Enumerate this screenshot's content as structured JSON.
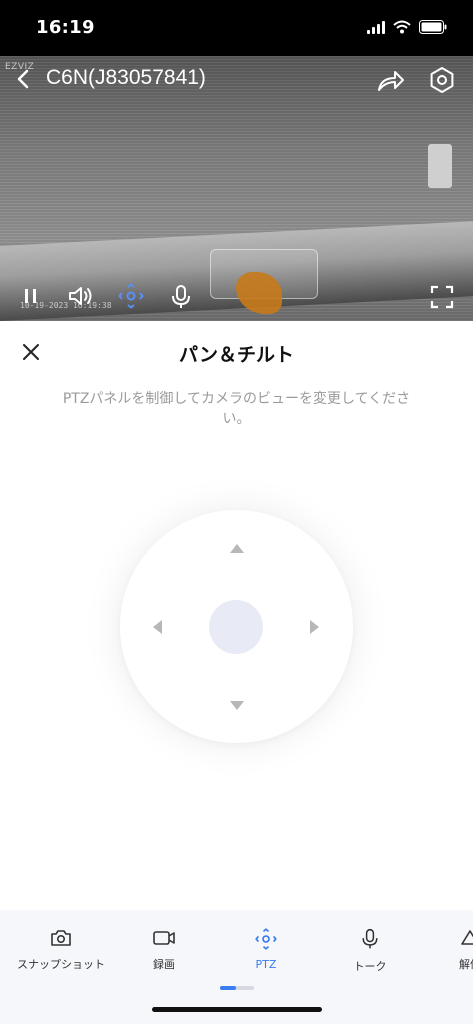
{
  "status_bar": {
    "time": "16:19"
  },
  "video": {
    "brand": "EZVIZ",
    "camera_title": "C6N(J83057841)",
    "timestamp": "10-19-2023 16:19:38",
    "icons": [
      "back-icon",
      "share-icon",
      "settings-icon",
      "pause-icon",
      "volume-icon",
      "ptz-icon",
      "microphone-icon",
      "fullscreen-icon"
    ]
  },
  "panel": {
    "title": "パン＆チルト",
    "description": "PTZパネルを制御してカメラのビューを変更してください。"
  },
  "toolbar": {
    "items": [
      {
        "label": "スナップショット",
        "icon": "camera-icon"
      },
      {
        "label": "録画",
        "icon": "video-record-icon"
      },
      {
        "label": "PTZ",
        "icon": "ptz-icon"
      },
      {
        "label": "トーク",
        "icon": "microphone-icon"
      },
      {
        "label": "解像",
        "icon": "resolution-icon"
      }
    ],
    "active_item": "PTZ"
  },
  "colors": {
    "accent": "#3b7cf0",
    "video_bg": "#7d7d7d",
    "toolbar_bg": "#f6f7fb"
  }
}
